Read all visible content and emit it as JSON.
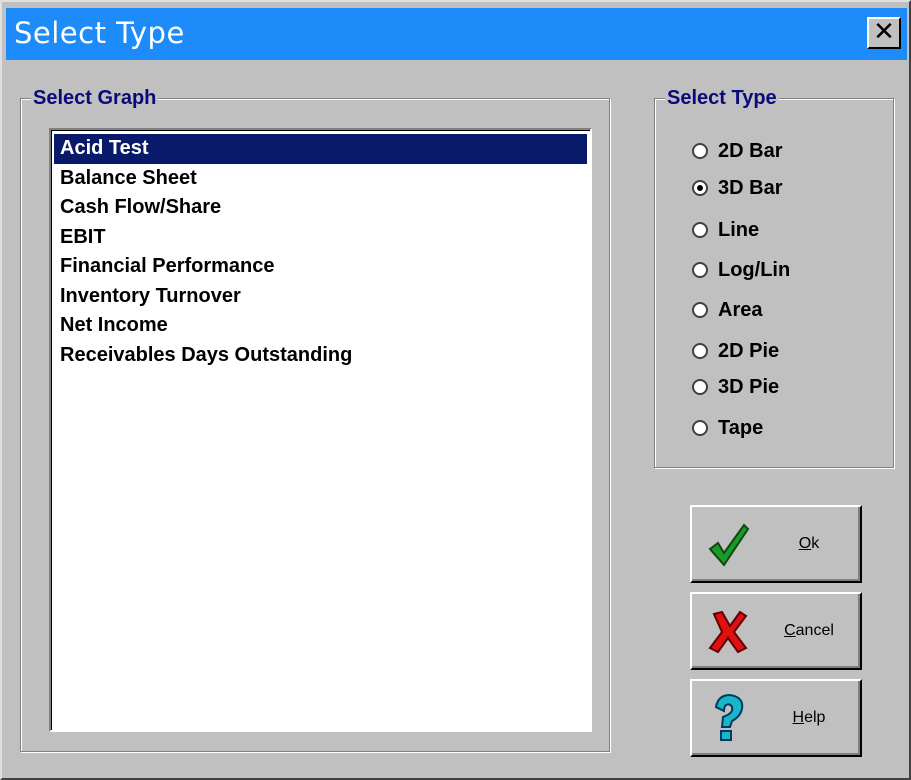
{
  "window": {
    "title": "Select Type",
    "close_glyph": "✕"
  },
  "select_graph": {
    "legend": "Select Graph",
    "items": [
      {
        "label": "Acid Test",
        "selected": true
      },
      {
        "label": "Balance Sheet",
        "selected": false
      },
      {
        "label": "Cash Flow/Share",
        "selected": false
      },
      {
        "label": "EBIT",
        "selected": false
      },
      {
        "label": "Financial Performance",
        "selected": false
      },
      {
        "label": "Inventory Turnover",
        "selected": false
      },
      {
        "label": "Net Income",
        "selected": false
      },
      {
        "label": "Receivables Days Outstanding",
        "selected": false
      }
    ]
  },
  "select_type": {
    "legend": "Select Type",
    "options": [
      {
        "label": "2D Bar",
        "checked": false
      },
      {
        "label": "3D Bar",
        "checked": true
      },
      {
        "label": "Line",
        "checked": false
      },
      {
        "label": "Log/Lin",
        "checked": false
      },
      {
        "label": "Area",
        "checked": false
      },
      {
        "label": "2D Pie",
        "checked": false
      },
      {
        "label": "3D Pie",
        "checked": false
      },
      {
        "label": "Tape",
        "checked": false
      }
    ]
  },
  "buttons": {
    "ok": {
      "mnemonic": "O",
      "rest": "k",
      "icon": "checkmark-icon"
    },
    "cancel": {
      "mnemonic": "C",
      "rest": "ancel",
      "icon": "red-x-icon"
    },
    "help": {
      "mnemonic": "H",
      "rest": "elp",
      "icon": "question-mark-icon"
    }
  },
  "colors": {
    "titlebar": "#1e8bfa",
    "selection": "#0a1a6a",
    "legend_text": "#0a0a7a",
    "face": "#c0c0c0"
  }
}
